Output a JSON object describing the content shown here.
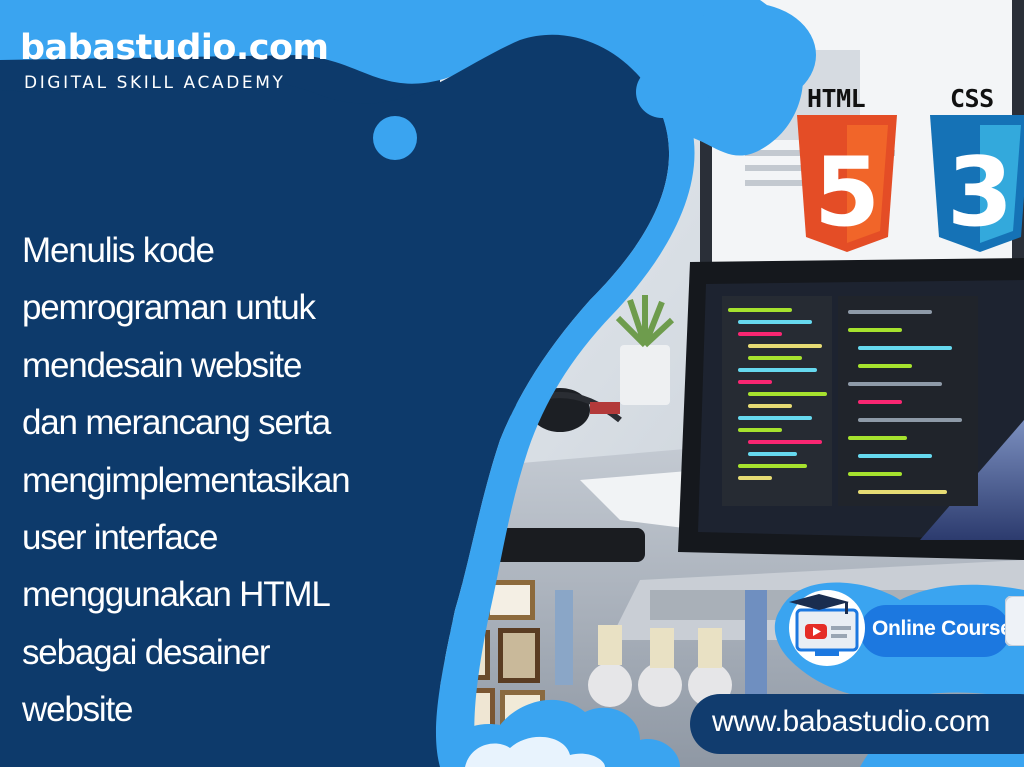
{
  "brand": {
    "title": "babastudio.com",
    "tagline": "DIGITAL SKILL ACADEMY"
  },
  "description": {
    "lines": [
      "Menulis kode",
      "pemrograman untuk",
      "mendesain website",
      "dan merancang serta",
      "mengimplementasikan",
      "user interface",
      "menggunakan HTML",
      "sebagai desainer",
      "website"
    ]
  },
  "badges": {
    "html": {
      "label": "HTML",
      "number": "5",
      "color": "#e44d26"
    },
    "css": {
      "label": "CSS",
      "number": "3",
      "color": "#1572b6"
    }
  },
  "online_course": {
    "label": "Online Course"
  },
  "website": {
    "url": "www.babastudio.com"
  },
  "colors": {
    "dark_navy": "#0d3a6b",
    "bright_blue": "#3aa4f0",
    "accent_blue": "#1c78e0"
  }
}
